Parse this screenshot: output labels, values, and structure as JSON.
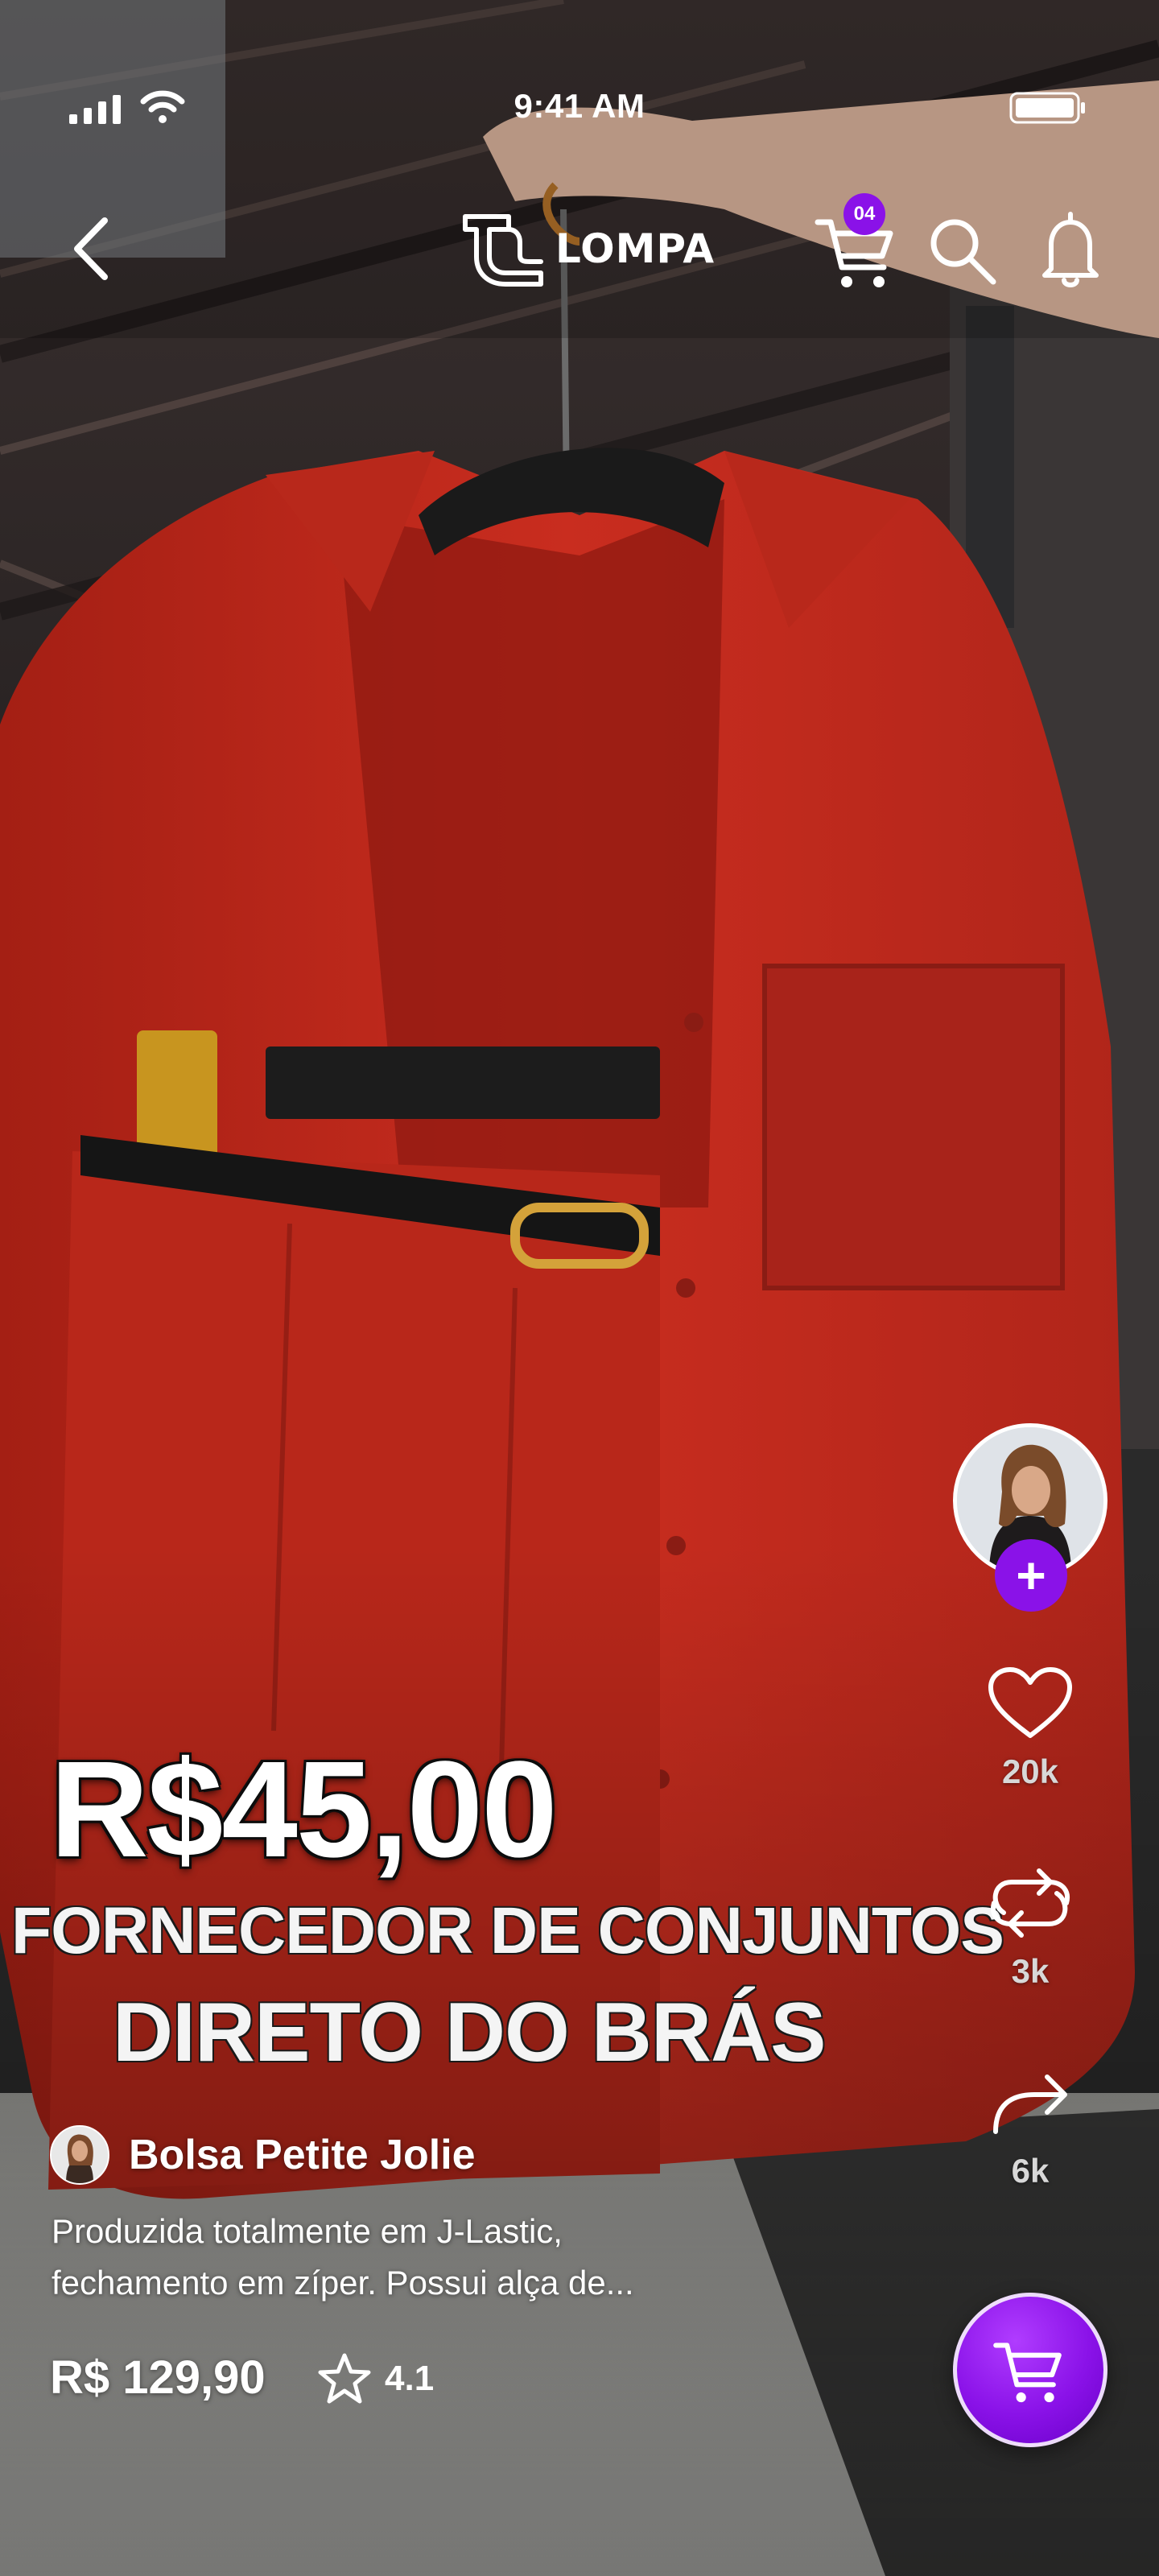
{
  "status_bar": {
    "time": "9:41 AM"
  },
  "header": {
    "brand": "LOMPA",
    "cart_count": "04"
  },
  "video_overlay": {
    "price": "R$45,00",
    "line1": "FORNECEDOR DE CONJUNTOS",
    "line2": "DIRETO DO BRÁS"
  },
  "actions": {
    "likes": "20k",
    "reposts": "3k",
    "shares": "6k",
    "follow_symbol": "+"
  },
  "product": {
    "seller_name": "Bolsa Petite Jolie",
    "description_line1": "Produzida totalmente em J-Lastic,",
    "description_line2": "fechamento em zíper. Possui alça de...",
    "price": "R$ 129,90",
    "rating": "4.1"
  },
  "colors": {
    "accent": "#8a12e8",
    "garment_red": "#c22a1c"
  },
  "icons": [
    "signal-icon",
    "wifi-icon",
    "battery-icon",
    "back-icon",
    "cart-icon",
    "search-icon",
    "bell-icon",
    "heart-icon",
    "repost-icon",
    "share-icon",
    "star-icon",
    "add-to-cart-icon"
  ]
}
